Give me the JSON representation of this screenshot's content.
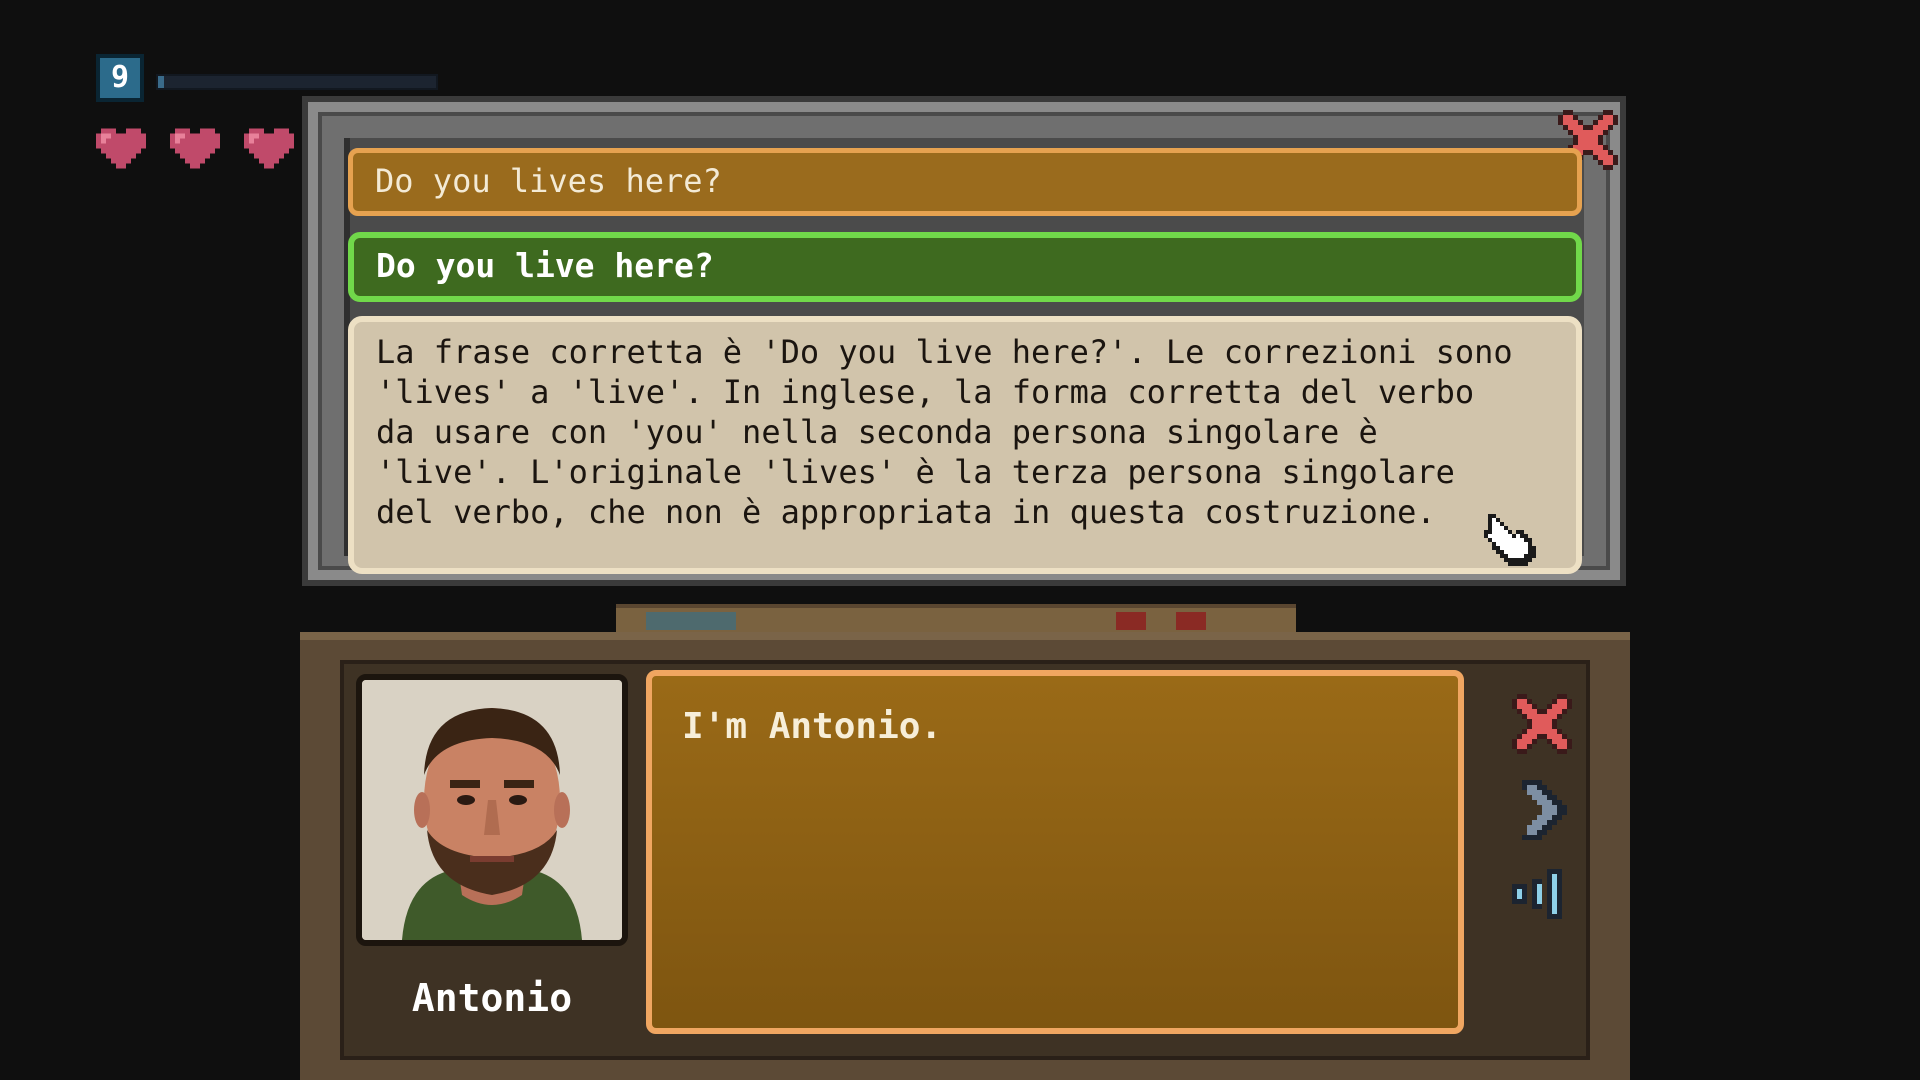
{
  "hud": {
    "level": "9",
    "xp_fraction": 0.02,
    "hearts": [
      {
        "icon": "heart-icon"
      },
      {
        "icon": "heart-icon"
      },
      {
        "icon": "heart-icon"
      }
    ]
  },
  "correction": {
    "original_sentence": "Do you lives here?",
    "corrected_sentence": "Do you live here?",
    "explanation": "La frase corretta è 'Do you live here?'. Le correzioni sono\n'lives' a 'live'. In inglese, la forma corretta del verbo\nda usare con 'you' nella seconda persona singolare è\n'live'. L'originale 'lives' è la terza persona singolare\ndel verbo, che non è appropriata in questa costruzione."
  },
  "dialog": {
    "speaker_name": "Antonio",
    "speech": "I'm Antonio.",
    "buttons": [
      "close-icon",
      "next-arrow-icon",
      "speaker-volume-icon"
    ]
  },
  "colors": {
    "wrong_row": "#9a6b1d",
    "correct_row": "#3e6a1f",
    "correct_border": "#71d84a",
    "speech_box": "#946513",
    "close_red": "#e04a4a"
  }
}
